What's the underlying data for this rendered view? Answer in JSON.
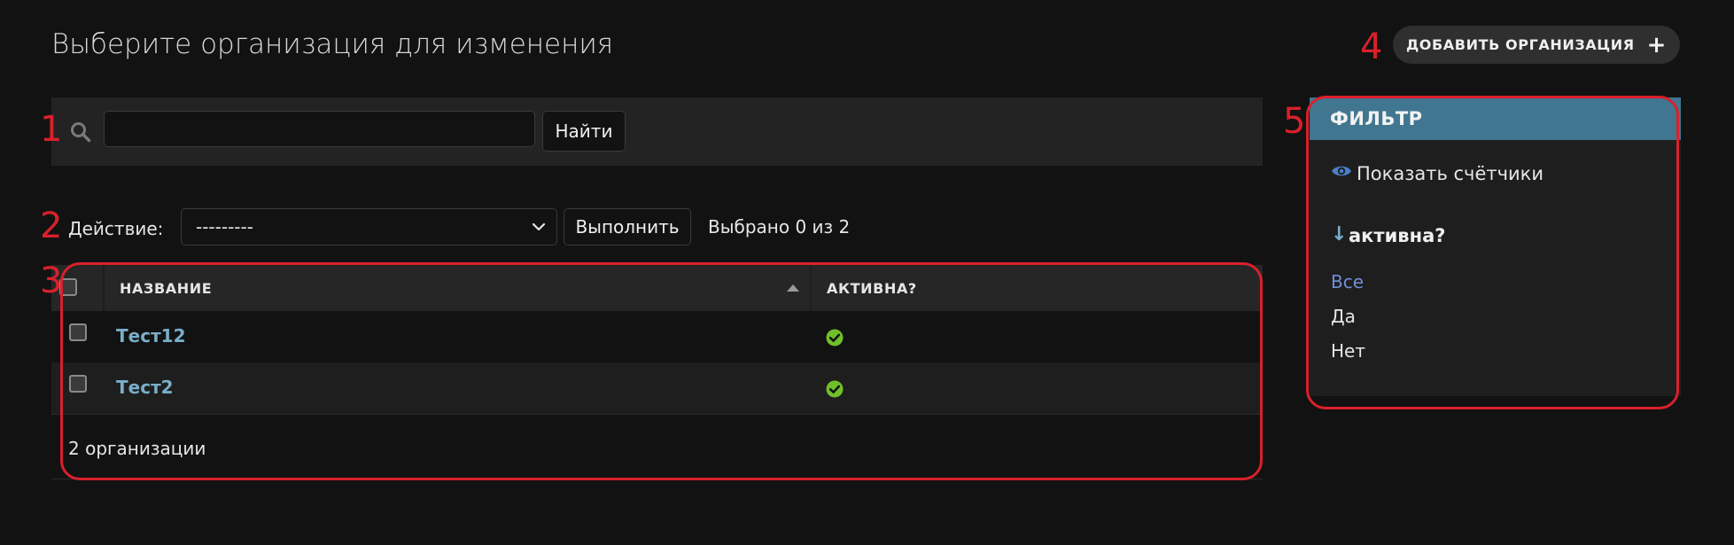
{
  "header": {
    "title": "Выберите организация для изменения",
    "add_button_label": "ДОБАВИТЬ ОРГАНИЗАЦИЯ"
  },
  "search": {
    "value": "",
    "placeholder": "",
    "submit_label": "Найти"
  },
  "actions": {
    "label": "Действие:",
    "selected_value": "---------",
    "run_label": "Выполнить",
    "selection_text": "Выбрано 0 из 2"
  },
  "table": {
    "columns": [
      "НАЗВАНИЕ",
      "АКТИВНА?"
    ],
    "rows": [
      {
        "name": "Тест12",
        "active": true
      },
      {
        "name": "Тест2",
        "active": true
      }
    ],
    "count_text": "2 организации"
  },
  "filter": {
    "header": "ФИЛЬТР",
    "show_counts_label": "Показать счётчики",
    "section_arrow": "↓",
    "section_title": "активна?",
    "options": [
      "Все",
      "Да",
      "Нет"
    ],
    "selected_option": "Все"
  },
  "annotations": {
    "labels": [
      "1",
      "2",
      "3",
      "4",
      "5"
    ],
    "color": "#d9202b"
  },
  "colors": {
    "background": "#121212",
    "panel": "#232323",
    "filter_header": "#417690",
    "link": "#79aec8",
    "selected_filter": "#6f8fd6",
    "success": "#70bf2b"
  }
}
